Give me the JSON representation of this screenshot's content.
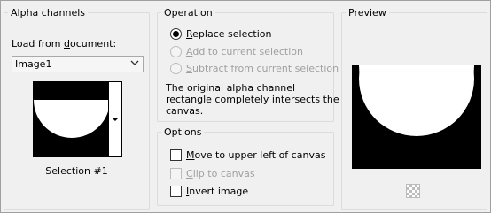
{
  "alpha_channels": {
    "title": "Alpha channels",
    "load_label_pre": "Load from ",
    "load_label_u": "d",
    "load_label_post": "ocument:",
    "document_value": "Image1",
    "selection_name": "Selection #1"
  },
  "operation": {
    "title": "Operation",
    "options": [
      {
        "u": "R",
        "rest": "eplace selection",
        "checked": true,
        "enabled": true
      },
      {
        "u": "A",
        "rest": "dd to current selection",
        "checked": false,
        "enabled": false
      },
      {
        "u": "S",
        "rest": "ubtract from current selection",
        "checked": false,
        "enabled": false
      }
    ],
    "note_line1": "The original alpha channel",
    "note_line2": "rectangle completely intersects the",
    "note_line3": "canvas."
  },
  "options": {
    "title": "Options",
    "items": [
      {
        "u": "M",
        "rest": "ove to upper left of canvas",
        "checked": false,
        "enabled": true
      },
      {
        "u": "C",
        "rest": "lip to canvas",
        "checked": false,
        "enabled": false
      },
      {
        "u": "I",
        "rest": "nvert image",
        "checked": false,
        "enabled": true
      }
    ]
  },
  "preview": {
    "title": "Preview",
    "background_color": "#000000",
    "selection_color": "#ffffff"
  }
}
